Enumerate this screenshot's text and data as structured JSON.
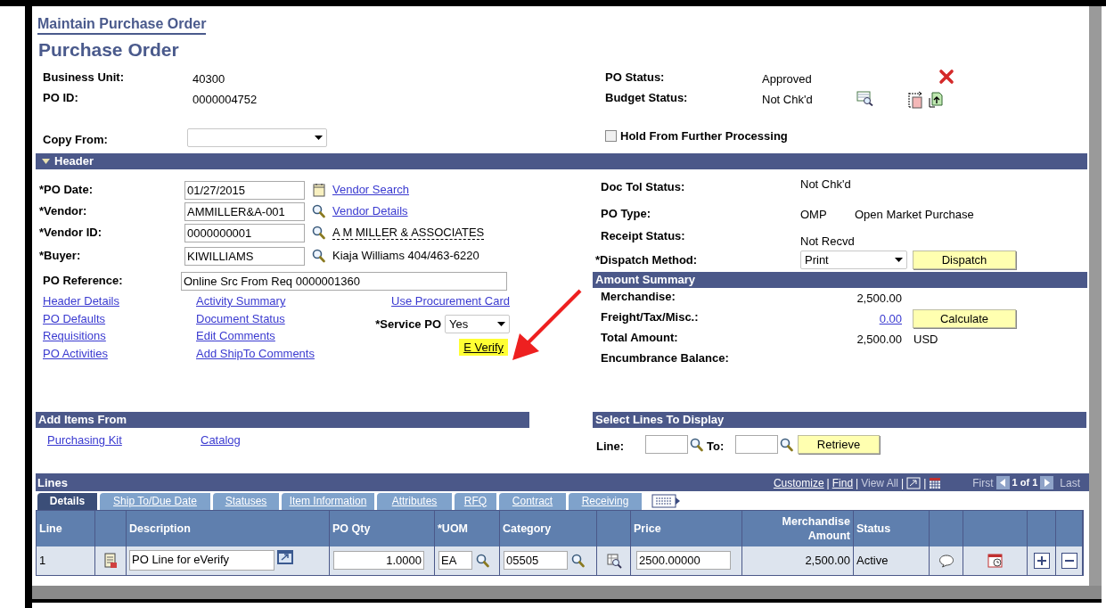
{
  "breadcrumb": "Maintain Purchase Order",
  "page_title": "Purchase Order",
  "summary_left": [
    {
      "label": "Business Unit:",
      "value": "40300"
    },
    {
      "label": "PO ID:",
      "value": "0000004752"
    }
  ],
  "summary_right": [
    {
      "label": "PO Status:",
      "value": "Approved"
    },
    {
      "label": "Budget Status:",
      "value": "Not Chk'd"
    }
  ],
  "copy_from": {
    "label": "Copy From:"
  },
  "hold": {
    "label": "Hold From Further Processing",
    "checked": false
  },
  "header_section": {
    "title": "Header",
    "expanded": true
  },
  "header_fields": [
    {
      "label": "*PO Date:",
      "value": "01/27/2015",
      "kind": "date",
      "link": "Vendor Search"
    },
    {
      "label": "*Vendor:",
      "value": "AMMILLER&A-001",
      "kind": "lookup",
      "link": "Vendor Details"
    },
    {
      "label": "*Vendor ID:",
      "value": "0000000001",
      "kind": "lookup",
      "note": "A M MILLER & ASSOCIATES"
    },
    {
      "label": "*Buyer:",
      "value": "KIWILLIAMS",
      "kind": "lookup",
      "note": "Kiaja Williams 404/463-6220"
    }
  ],
  "po_reference": {
    "label": "PO Reference:",
    "value": "Online Src From Req 0000001360"
  },
  "link_columns": [
    [
      "Header Details",
      "PO Defaults",
      "Requisitions",
      "PO Activities"
    ],
    [
      "Activity Summary",
      "Document Status",
      "Edit Comments",
      "Add ShipTo Comments"
    ]
  ],
  "procurement_card_link": "Use Procurement Card",
  "service_po": {
    "label": "*Service PO",
    "value": "Yes"
  },
  "e_verify": {
    "label": "E Verify",
    "highlighted": true
  },
  "status_fields": [
    {
      "label": "Doc Tol Status:",
      "value": "Not Chk'd"
    },
    {
      "label": "PO Type:",
      "value": "OMP",
      "description": "Open Market Purchase"
    },
    {
      "label": "Receipt Status:",
      "value": "Not Recvd"
    }
  ],
  "dispatch": {
    "label": "*Dispatch Method:",
    "value": "Print",
    "button": "Dispatch"
  },
  "amount_summary": {
    "title": "Amount Summary",
    "rows": [
      {
        "label": "Merchandise:",
        "value": "2,500.00",
        "kind": "text"
      },
      {
        "label": "Freight/Tax/Misc.:",
        "value": "0.00",
        "kind": "link",
        "button": "Calculate"
      },
      {
        "label": "Total Amount:",
        "value": "2,500.00",
        "currency": "USD",
        "kind": "text"
      },
      {
        "label": "Encumbrance Balance:"
      }
    ]
  },
  "add_items": {
    "title": "Add Items From",
    "links": [
      "Purchasing Kit",
      "Catalog"
    ]
  },
  "select_lines": {
    "title": "Select Lines To Display",
    "line_label": "Line:",
    "to_label": "To:",
    "button": "Retrieve"
  },
  "lines": {
    "title": "Lines",
    "nav": [
      {
        "text": "Customize",
        "kind": "link"
      },
      {
        "text": "|",
        "kind": "sep"
      },
      {
        "text": "Find",
        "kind": "link"
      },
      {
        "text": "|",
        "kind": "sep"
      },
      {
        "text": "View All",
        "kind": "muted"
      },
      {
        "text": "|",
        "kind": "sep"
      },
      {
        "kind": "zoom"
      },
      {
        "text": "|",
        "kind": "sep"
      },
      {
        "kind": "grid"
      },
      {
        "text": "First",
        "kind": "muted"
      },
      {
        "kind": "prev"
      },
      {
        "text": "1 of 1",
        "kind": "count"
      },
      {
        "kind": "next"
      },
      {
        "text": "Last",
        "kind": "muted"
      }
    ],
    "tabs": [
      {
        "label": "Details",
        "selected": true
      },
      {
        "label": "Ship To/Due Date",
        "selected": false
      },
      {
        "label": "Statuses",
        "selected": false
      },
      {
        "label": "Item Information",
        "selected": false
      },
      {
        "label": "Attributes",
        "selected": false
      },
      {
        "label": "RFQ",
        "selected": false
      },
      {
        "label": "Contract",
        "selected": false
      },
      {
        "label": "Receiving",
        "selected": false
      }
    ],
    "columns": [
      {
        "label": "Line",
        "kind": "text"
      },
      {
        "kind": "icon"
      },
      {
        "label": "Description",
        "kind": "text"
      },
      {
        "label": "PO Qty",
        "kind": "text"
      },
      {
        "label": "*UOM",
        "kind": "text"
      },
      {
        "label": "Category",
        "kind": "text"
      },
      {
        "kind": "icon"
      },
      {
        "label": "Price",
        "kind": "text"
      },
      {
        "label": "Merchandise Amount",
        "kind": "right"
      },
      {
        "label": "Status",
        "kind": "text"
      },
      {
        "kind": "icon"
      },
      {
        "kind": "icon"
      },
      {
        "kind": "icon"
      },
      {
        "kind": "icon"
      }
    ],
    "rows": [
      {
        "line": "1",
        "description": "PO Line for eVerify",
        "po_qty": "1.0000",
        "uom": "EA",
        "category": "05505",
        "price": "2500.00000",
        "merchandise_amount": "2,500.00",
        "status": "Active"
      }
    ]
  }
}
